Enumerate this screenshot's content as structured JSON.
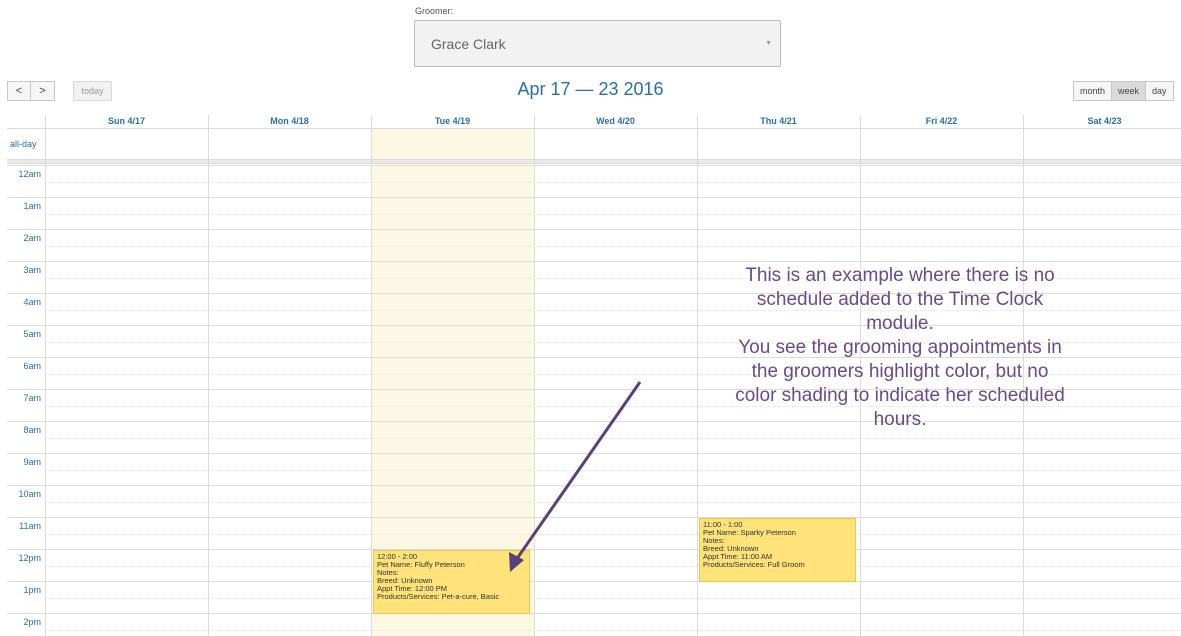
{
  "groomer": {
    "label": "Groomer:",
    "value": "Grace Clark"
  },
  "toolbar": {
    "prev": "<",
    "next": ">",
    "today": "today",
    "title": "Apr 17 — 23 2016",
    "views": [
      "month",
      "week",
      "day"
    ],
    "active_view": "week"
  },
  "calendar": {
    "days": [
      "Sun 4/17",
      "Mon 4/18",
      "Tue 4/19",
      "Wed 4/20",
      "Thu 4/21",
      "Fri 4/22",
      "Sat 4/23"
    ],
    "today_day": "Tue 4/19",
    "allday_label": "all-day",
    "hours": [
      "12am",
      "1am",
      "2am",
      "3am",
      "4am",
      "5am",
      "6am",
      "7am",
      "8am",
      "9am",
      "10am",
      "11am",
      "12pm",
      "1pm",
      "2pm"
    ]
  },
  "events": [
    {
      "day": "Tue 4/19",
      "time": "12:00 - 2:00",
      "pet": "Pet Name: Fluffy Peterson",
      "notes": "Notes:",
      "breed": "Breed: Unknown",
      "appt": "Appt Time: 12:00 PM",
      "products": "Products/Services: Pet-a-cure, Basic"
    },
    {
      "day": "Thu 4/21",
      "time": "11:00 - 1:00",
      "pet": "Pet Name: Sparky Peterson",
      "notes": "Notes:",
      "breed": "Breed: Unknown",
      "appt": "Appt Time: 11:00 AM",
      "products": "Products/Services: Full Groom"
    }
  ],
  "annotation": {
    "lines": [
      "This is an example where there is no",
      "schedule added to the Time Clock",
      "module.",
      "You see the grooming appointments in",
      "the groomers highlight color,  but no",
      "color shading to indicate her scheduled",
      "hours."
    ],
    "color": "#6b4a8a"
  },
  "colors": {
    "accent": "#2a6fa8",
    "event": "#ffe27a",
    "today_highlight": "#fcf8e3"
  }
}
